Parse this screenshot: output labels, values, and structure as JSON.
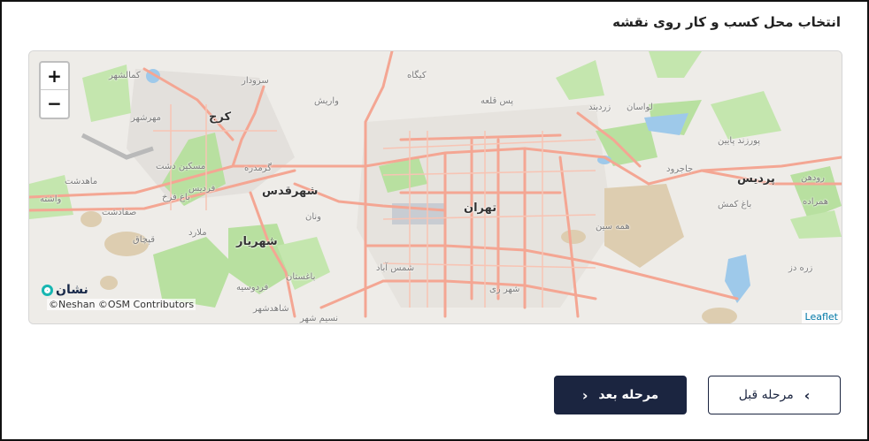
{
  "page": {
    "title": "انتخاب محل کسب و کار روی نقشه"
  },
  "map": {
    "zoom_in": "+",
    "zoom_out": "−",
    "brand": "نشان",
    "attribution": "©Neshan ©OSM Contributors",
    "leaflet": "Leaflet",
    "labels": {
      "tehran": "تهران",
      "karaj": "کرج",
      "shahr_qods": "شهرقدس",
      "shahriar": "شهریار",
      "pardis": "پردیس",
      "kamalshahr": "کمالشهر",
      "mehrshahr": "مهرشهر",
      "sardar": "سرودار",
      "varish": "واریش",
      "kigah": "کیگاه",
      "pas_qale": "پس قلعه",
      "lavasan": "لواسان",
      "zardband": "زردبند",
      "porzhd_paein": "پورزند پایین",
      "jajrood": "جاجرود",
      "roudehen": "رودهن",
      "bagh_kamsh": "باغ کمش",
      "hamerdeh": "همراده",
      "meskin_dasht": "مسکین دشت",
      "mahdasht": "ماهدشت",
      "garmdareh": "گرمدره",
      "fardis": "فردیس",
      "bagh_farah": "باغ فرخ",
      "malard": "ملارد",
      "qajaq": "قپچاق",
      "safadasht": "صفادشت",
      "vashteh": "واشته",
      "vanan": "ونان",
      "baghestan": "باغستان",
      "ferdowsieh": "فردوسیه",
      "shahedshahr": "شاهدشهر",
      "nasim_shahr": "نسیم شهر",
      "shams_abad": "شمس آباد",
      "shahr_rey": "شهر ری",
      "hameh_sin": "همه سین",
      "zarah_dar": "زره دز"
    }
  },
  "actions": {
    "prev_label": "مرحله قبل",
    "next_label": "مرحله بعد"
  },
  "colors": {
    "primary": "#1b2540",
    "road": "#f4a693",
    "park": "#b8e0a0",
    "water": "#9ec9ea",
    "sand": "#ddcdb0"
  }
}
